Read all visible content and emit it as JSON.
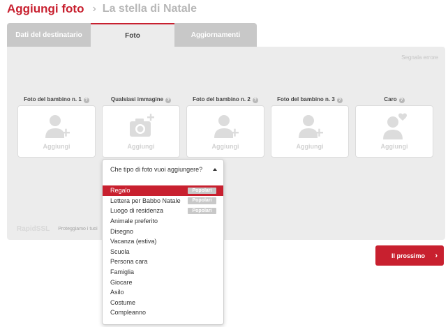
{
  "header": {
    "title": "Aggiungi foto",
    "separator": "›",
    "breadcrumb": "La stella di Natale"
  },
  "tabs": [
    {
      "label": "Dati del destinatario",
      "active": false
    },
    {
      "label": "Foto",
      "active": true
    },
    {
      "label": "Aggiornamenti",
      "active": false
    }
  ],
  "report_error": "Segnala errore",
  "slots": [
    {
      "label": "Foto del bambino n. 1",
      "icon": "add-person-icon",
      "add": "Aggiungi"
    },
    {
      "label": "Qualsiasi immagine",
      "icon": "add-camera-icon",
      "add": "Aggiungi"
    },
    {
      "label": "Foto del bambino n. 2",
      "icon": "add-person-icon",
      "add": "Aggiungi"
    },
    {
      "label": "Foto del bambino n. 3",
      "icon": "add-person-icon",
      "add": "Aggiungi"
    },
    {
      "label": "Caro",
      "icon": "heart-person-icon",
      "add": "Aggiungi"
    }
  ],
  "help_glyph": "?",
  "footer": {
    "brand": "RapidSSL",
    "text": "Proteggiamo i tuoi"
  },
  "next_button": {
    "label": "Il prossimo",
    "arrow": "›"
  },
  "dropdown": {
    "question": "Che tipo di foto vuoi aggiungere?",
    "items": [
      {
        "label": "Regalo",
        "badge": "Popolari",
        "selected": true
      },
      {
        "label": "Lettera per Babbo Natale",
        "badge": "Popolari"
      },
      {
        "label": "Luogo di residenza",
        "badge": "Popolari"
      },
      {
        "label": "Animale preferito"
      },
      {
        "label": "Disegno"
      },
      {
        "label": "Vacanza (estiva)"
      },
      {
        "label": "Scuola"
      },
      {
        "label": "Persona cara"
      },
      {
        "label": "Famiglia"
      },
      {
        "label": "Giocare"
      },
      {
        "label": "Asilo"
      },
      {
        "label": "Costume"
      },
      {
        "label": "Compleanno"
      }
    ]
  },
  "colors": {
    "accent": "#c8202f",
    "panel": "#ececec",
    "tab_inactive": "#c8c8c8",
    "icon": "#dcdcdc"
  }
}
